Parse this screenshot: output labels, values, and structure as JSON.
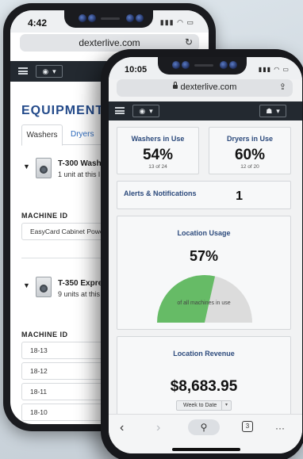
{
  "back_phone": {
    "time": "4:42",
    "url": "dexterlive.com",
    "reload_glyph": "↻",
    "section_title": "EQUIPMENT",
    "tabs": [
      "Washers",
      "Dryers"
    ],
    "equipment": [
      {
        "name": "T-300 Washer",
        "summary": "1 unit at this l",
        "column_header": "MACHINE ID",
        "rows": [
          "EasyCard Cabinet Power"
        ]
      },
      {
        "name": "T-350 Express",
        "summary": "9 units at this",
        "column_header": "MACHINE ID",
        "rows": [
          "18-13",
          "18-12",
          "18-11",
          "18-10"
        ]
      }
    ]
  },
  "front_phone": {
    "time": "10:05",
    "url": "dexterlive.com",
    "washers": {
      "title": "Washers in Use",
      "percent": "54%",
      "detail": "13 of 24"
    },
    "dryers": {
      "title": "Dryers in Use",
      "percent": "60%",
      "detail": "12 of 20"
    },
    "alerts": {
      "title": "Alerts & Notifications",
      "count": "1"
    },
    "usage": {
      "title": "Location Usage",
      "percent": "57%",
      "caption": "of all machines in use",
      "value": 0.57,
      "fill_color": "#66bb66",
      "track_color": "#dcdcdc"
    },
    "revenue": {
      "title": "Location Revenue",
      "amount": "$8,683.95",
      "period": "Week to Date"
    },
    "toolbar": {
      "back": "‹",
      "forward": "›",
      "search": "⚲",
      "tabs": "3",
      "more": "···"
    }
  },
  "colors": {
    "navbar": "#232930",
    "heading": "#2c4a7c",
    "equipment_title": "#234a8a",
    "link": "#2f6bbd"
  }
}
